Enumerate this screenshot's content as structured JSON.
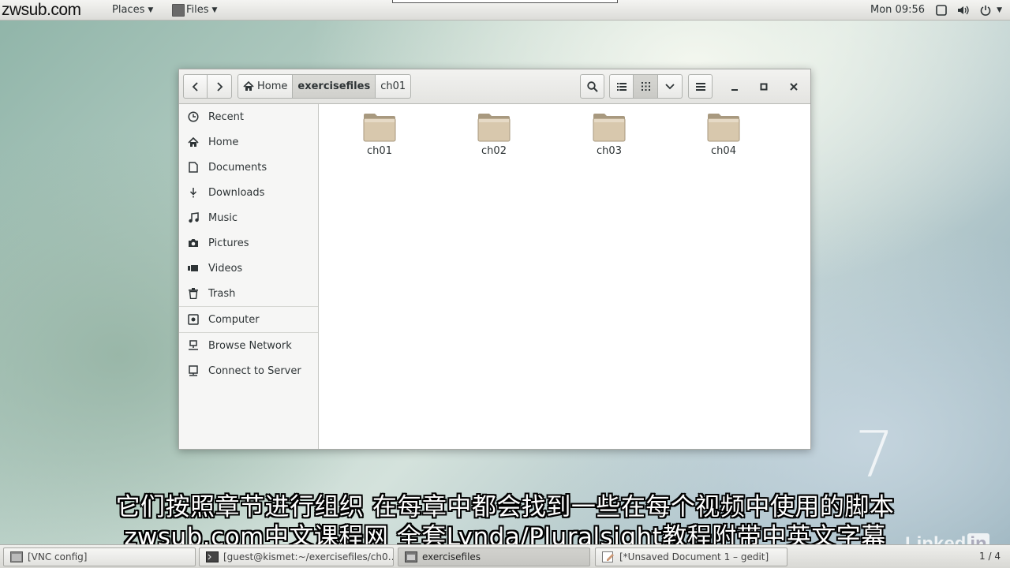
{
  "topbar": {
    "watermark": "zwsub.com",
    "places": "Places",
    "files": "Files",
    "clock": "Mon 09:56"
  },
  "window": {
    "path": [
      "Home",
      "exercisefiles",
      "ch01"
    ],
    "active_crumb": "exercisefiles"
  },
  "sidebar": {
    "items": [
      {
        "label": "Recent",
        "icon": "clock-icon"
      },
      {
        "label": "Home",
        "icon": "home-icon"
      },
      {
        "label": "Documents",
        "icon": "document-icon"
      },
      {
        "label": "Downloads",
        "icon": "download-icon"
      },
      {
        "label": "Music",
        "icon": "music-icon"
      },
      {
        "label": "Pictures",
        "icon": "camera-icon"
      },
      {
        "label": "Videos",
        "icon": "video-icon"
      },
      {
        "label": "Trash",
        "icon": "trash-icon"
      },
      {
        "label": "Computer",
        "icon": "computer-icon"
      },
      {
        "label": "Browse Network",
        "icon": "network-icon"
      },
      {
        "label": "Connect to Server",
        "icon": "server-icon"
      }
    ]
  },
  "folders": [
    "ch01",
    "ch02",
    "ch03",
    "ch04"
  ],
  "desktop": {
    "logo": "7",
    "subtitle_line1": "它们按照章节进行组织 在每章中都会找到一些在每个视频中使用的脚本",
    "subtitle_line2": "zwsub.com中文课程网 全套Lynda/Pluralsight教程附带中英文字幕",
    "brand": "Linked",
    "brand_in": "in"
  },
  "taskbar": {
    "tasks": [
      "[VNC config]",
      "[guest@kismet:~/exercisefiles/ch0…",
      "exercisefiles",
      "[*Unsaved Document 1 – gedit]"
    ],
    "pager": "1 / 4"
  },
  "colors": {
    "folder": "#d8c8ad",
    "folder_dark": "#a8997f"
  }
}
